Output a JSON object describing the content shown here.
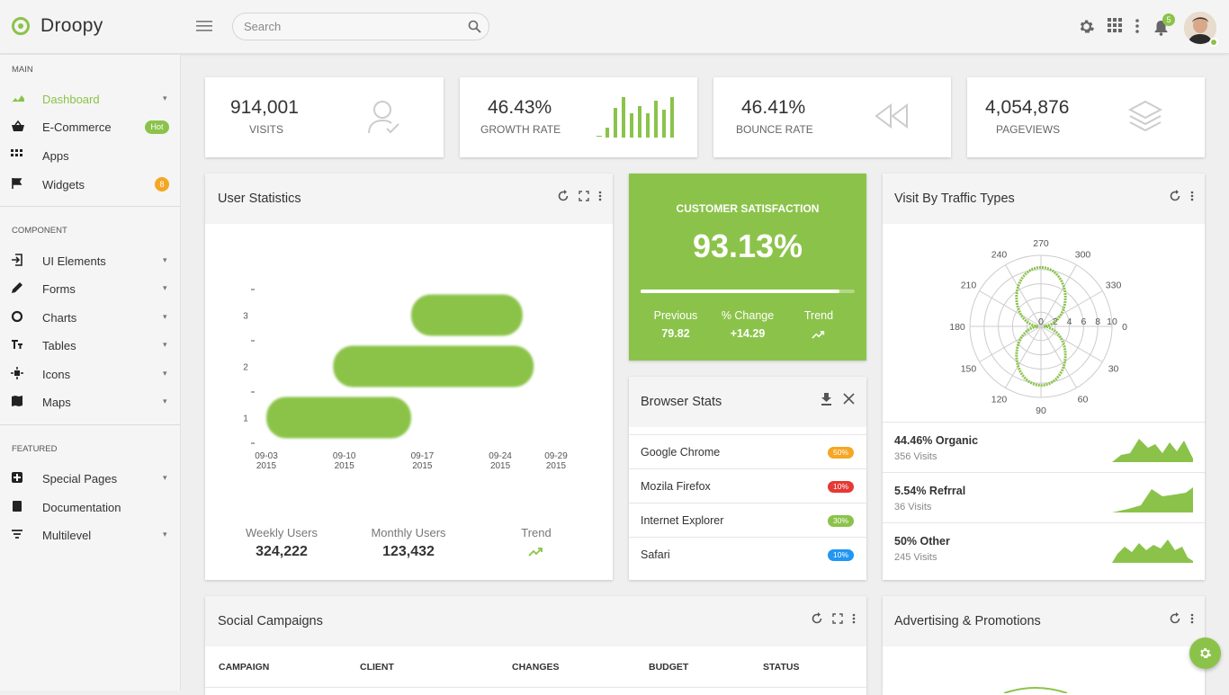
{
  "app": {
    "name": "Droopy"
  },
  "search": {
    "placeholder": "Search"
  },
  "topbar": {
    "notifications_count": "5"
  },
  "colors": {
    "accent": "#8bc34a",
    "orange": "#f5a623",
    "red": "#e53935",
    "blue": "#2196f3"
  },
  "sidebar": {
    "sections": {
      "main": "MAIN",
      "component": "COMPONENT",
      "featured": "FEATURED"
    },
    "main_items": [
      {
        "label": "Dashboard",
        "icon": "dashboard-icon"
      },
      {
        "label": "E-Commerce",
        "icon": "basket-icon",
        "badge": "Hot"
      },
      {
        "label": "Apps",
        "icon": "apps-icon"
      },
      {
        "label": "Widgets",
        "icon": "flag-icon",
        "badge": "8"
      }
    ],
    "component_items": [
      {
        "label": "UI Elements",
        "icon": "ui-elements-icon"
      },
      {
        "label": "Forms",
        "icon": "pencil-icon"
      },
      {
        "label": "Charts",
        "icon": "chart-ring-icon"
      },
      {
        "label": "Tables",
        "icon": "tables-icon"
      },
      {
        "label": "Icons",
        "icon": "icons-icon"
      },
      {
        "label": "Maps",
        "icon": "map-icon"
      }
    ],
    "featured_items": [
      {
        "label": "Special Pages",
        "icon": "special-pages-icon"
      },
      {
        "label": "Documentation",
        "icon": "book-icon"
      },
      {
        "label": "Multilevel",
        "icon": "filter-icon"
      }
    ]
  },
  "stats": [
    {
      "value": "914,001",
      "label": "VISITS",
      "icon": "user-check-icon"
    },
    {
      "value": "46.43%",
      "label": "GROWTH RATE",
      "icon": "bar-sparkline-icon"
    },
    {
      "value": "46.41%",
      "label": "BOUNCE RATE",
      "icon": "rewind-icon"
    },
    {
      "value": "4,054,876",
      "label": "PAGEVIEWS",
      "icon": "layers-icon"
    }
  ],
  "user_statistics": {
    "title": "User Statistics",
    "weekly_label": "Weekly Users",
    "weekly_value": "324,222",
    "monthly_label": "Monthly Users",
    "monthly_value": "123,432",
    "trend_label": "Trend"
  },
  "customer_satisfaction": {
    "title": "CUSTOMER SATISFACTION",
    "value": "93.13%",
    "progress": 0.93,
    "previous_label": "Previous",
    "previous_value": "79.82",
    "change_label": "% Change",
    "change_value": "+14.29",
    "trend_label": "Trend"
  },
  "browser_stats": {
    "title": "Browser Stats",
    "rows": [
      {
        "name": "Google Chrome",
        "pct": "50%",
        "color": "#f5a623"
      },
      {
        "name": "Mozila Firefox",
        "pct": "10%",
        "color": "#e53935"
      },
      {
        "name": "Internet Explorer",
        "pct": "30%",
        "color": "#8bc34a"
      },
      {
        "name": "Safari",
        "pct": "10%",
        "color": "#2196f3"
      }
    ]
  },
  "traffic_types": {
    "title": "Visit By Traffic Types",
    "rows": [
      {
        "title": "44.46% Organic",
        "visits": "356 Visits"
      },
      {
        "title": "5.54% Refrral",
        "visits": "36 Visits"
      },
      {
        "title": "50% Other",
        "visits": "245 Visits"
      }
    ]
  },
  "social_campaigns": {
    "title": "Social Campaigns",
    "columns": [
      "CAMPAIGN",
      "CLIENT",
      "CHANGES",
      "BUDGET",
      "STATUS"
    ]
  },
  "advertising": {
    "title": "Advertising & Promotions"
  },
  "chart_data": [
    {
      "type": "bar",
      "orientation": "horizontal",
      "y_categories": [
        "1",
        "2",
        "3"
      ],
      "x_tick_labels": [
        "09-03 2015",
        "09-10 2015",
        "09-17 2015",
        "09-24 2015",
        "09-29 2015"
      ],
      "x_ticks": [
        "2015-09-03",
        "2015-09-10",
        "2015-09-17",
        "2015-09-24",
        "2015-09-29"
      ],
      "xlim": [
        "2015-09-03",
        "2015-09-29"
      ],
      "bars": [
        {
          "y": "1",
          "start": "2015-09-03",
          "end": "2015-09-16"
        },
        {
          "y": "2",
          "start": "2015-09-09",
          "end": "2015-09-27"
        },
        {
          "y": "3",
          "start": "2015-09-16",
          "end": "2015-09-26"
        }
      ],
      "color": "#8bc34a"
    },
    {
      "type": "polar",
      "angle_labels": [
        "0",
        "30",
        "60",
        "90",
        "120",
        "150",
        "180",
        "210",
        "240",
        "270",
        "300",
        "330"
      ],
      "radial_labels": [
        "0",
        "2",
        "4",
        "6",
        "8",
        "10"
      ],
      "rmax": 10,
      "shape": "cardioid",
      "color": "#8bc34a"
    }
  ]
}
